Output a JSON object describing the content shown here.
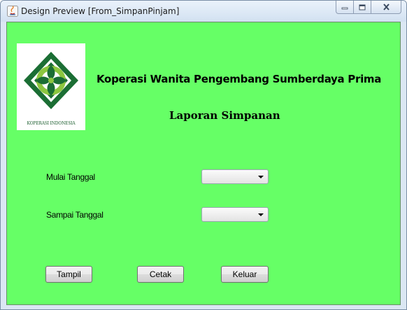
{
  "window": {
    "title": "Design Preview [From_SimpanPinjam]",
    "controls": [
      "minimize-icon",
      "maximize-icon",
      "close-icon"
    ]
  },
  "header": {
    "logo_caption": "KOPERASI INDONESIA",
    "organization": "Koperasi Wanita Pengembang Sumberdaya Prima",
    "report_title": "Laporan Simpanan"
  },
  "form": {
    "start_date_label": "Mulai Tanggal",
    "start_date_value": "",
    "end_date_label": "Sampai Tanggal",
    "end_date_value": ""
  },
  "buttons": {
    "show": "Tampil",
    "print": "Cetak",
    "exit": "Keluar"
  },
  "colors": {
    "panel_background": "#66ff66",
    "logo_green_dark": "#1b6e34",
    "logo_green_light": "#8cc63f"
  }
}
